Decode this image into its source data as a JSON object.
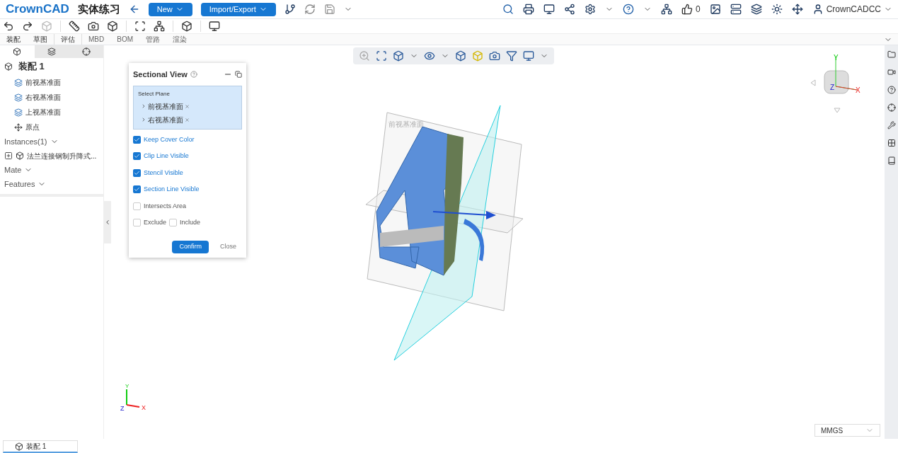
{
  "header": {
    "logo": "CrownCAD",
    "title": "实体练习",
    "buttons": [
      {
        "label": "New"
      },
      {
        "label": "Import/Export"
      }
    ],
    "likes": "0",
    "user": "CrownCADCC"
  },
  "menu_tabs": [
    "装配",
    "草图",
    "评估",
    "MBD",
    "BOM",
    "管路",
    "渲染"
  ],
  "panel_tabs": [
    {
      "selected": true
    },
    {
      "selected": false
    },
    {
      "selected": false
    }
  ],
  "tree": {
    "root": "装配 1",
    "planes": [
      "前视基准面",
      "右视基准面",
      "上视基准面"
    ],
    "origin": "原点",
    "instances_label": "Instances(1)",
    "instance": "法兰连接钢制升降式...",
    "sections": [
      "Mate",
      "Features"
    ]
  },
  "sectional_view": {
    "title": "Sectional View",
    "select_label": "Select Plane",
    "planes": [
      "前视基准面",
      "右视基准面"
    ],
    "options": [
      {
        "label": "Keep Cover Color",
        "checked": true
      },
      {
        "label": "Clip Line Visible",
        "checked": true
      },
      {
        "label": "Stencil Visible",
        "checked": true
      },
      {
        "label": "Section Line Visible",
        "checked": true
      },
      {
        "label": "Intersects Area",
        "checked": false
      }
    ],
    "filters": [
      {
        "label": "Exclude",
        "checked": false
      },
      {
        "label": "Include",
        "checked": false
      }
    ],
    "confirm": "Confirm",
    "close": "Close"
  },
  "viewport": {
    "plane_label": "前视基准面",
    "axes": [
      "X",
      "Y",
      "Z"
    ],
    "cube_axes": [
      "X",
      "Y",
      "Z"
    ],
    "units": "MMGS"
  },
  "bottom_tab": "装配 1"
}
